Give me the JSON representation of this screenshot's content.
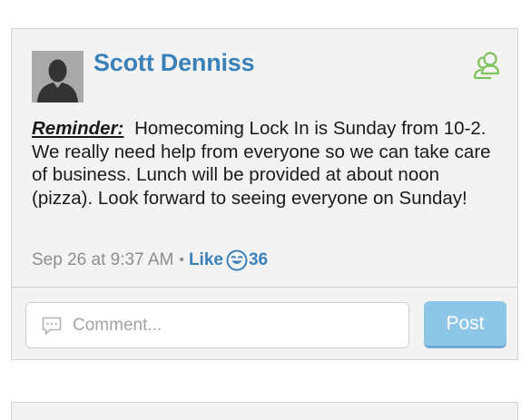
{
  "post": {
    "author": "Scott Denniss",
    "reminder_label": "Reminder:",
    "body": "Homecoming Lock In is Sunday from 10-2.  We really need help from everyone so we can take care of business.  Lunch will be provided at about noon (pizza).  Look forward to seeing everyone on Sunday!",
    "timestamp": "Sep 26 at 9:37 AM",
    "separator": "•",
    "like_label": "Like",
    "like_count": "36"
  },
  "comment": {
    "placeholder": "Comment...",
    "post_label": "Post"
  },
  "icons": {
    "avatar": "default-user-silhouette-icon",
    "group": "people-icon",
    "like": "smiley-icon",
    "comment": "speech-bubble-icon"
  },
  "colors": {
    "accent": "#3a81ba",
    "group_icon": "#7cc35a",
    "post_button": "#8dc6e6",
    "card_background": "#f3f3f3",
    "meta_text": "#8e8e8e"
  }
}
